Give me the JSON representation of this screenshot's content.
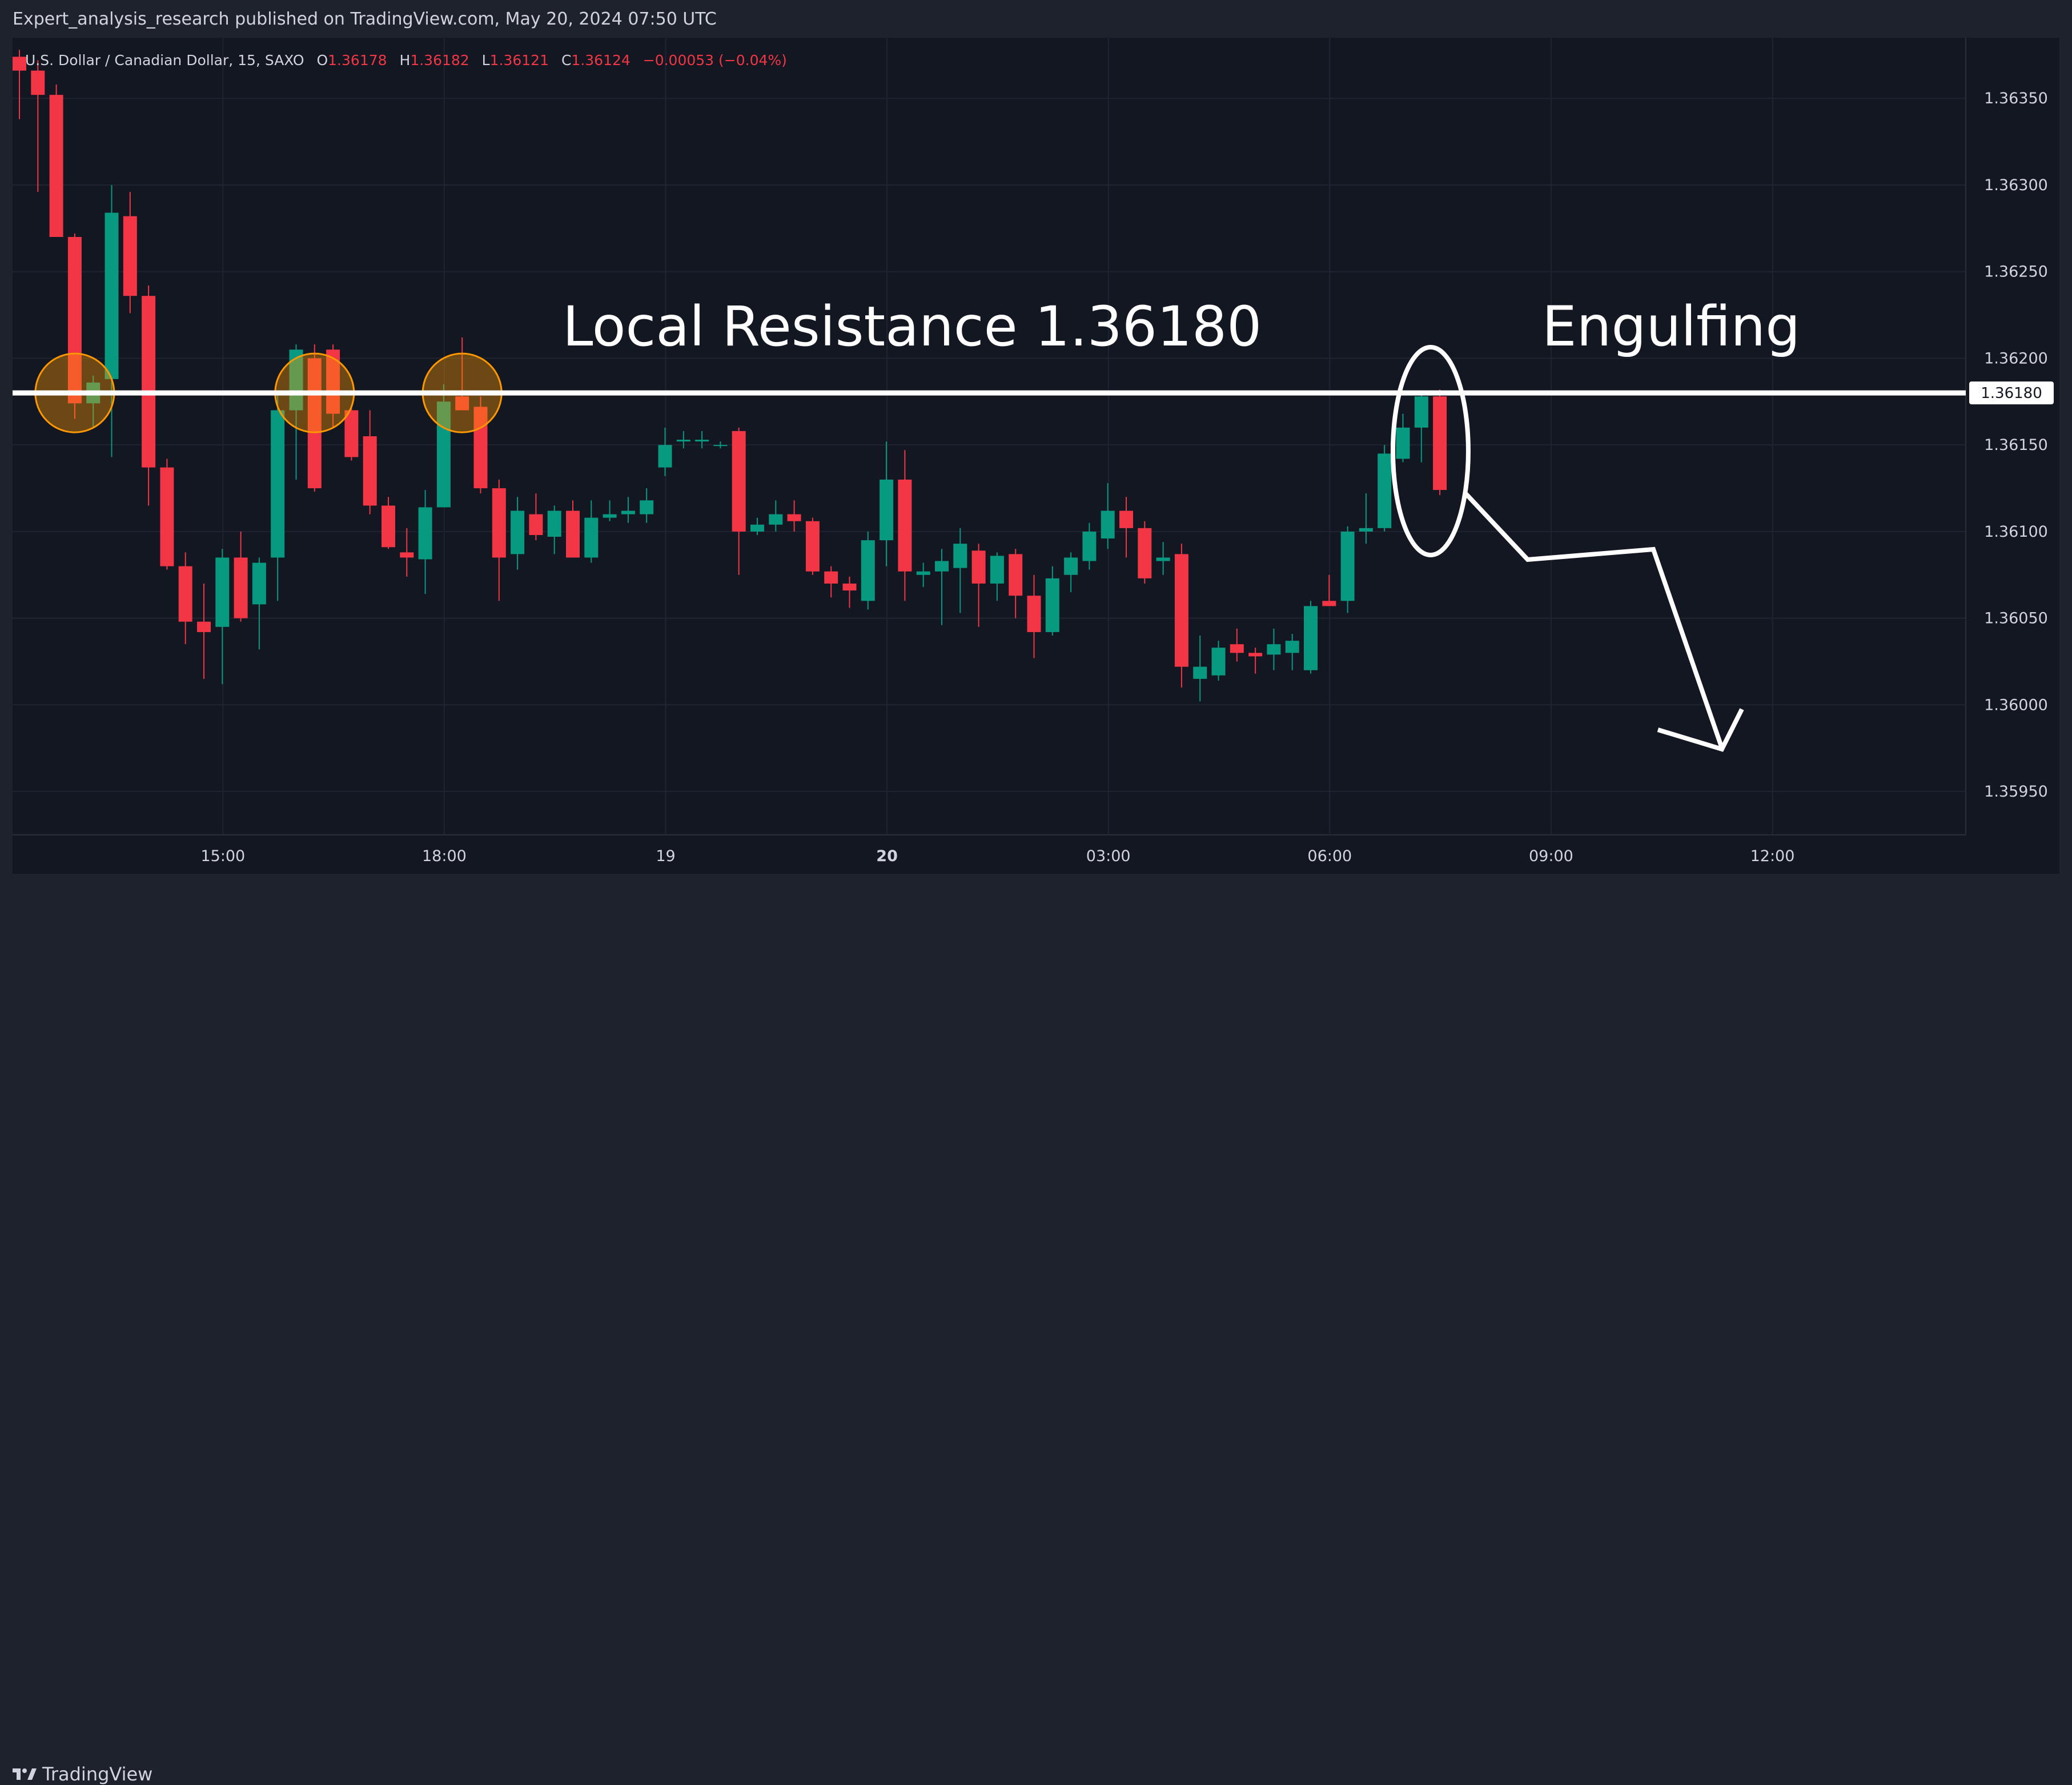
{
  "header": {
    "published": "Expert_analysis_research published on TradingView.com, May 20, 2024 07:50 UTC"
  },
  "legend": {
    "symbol": "U.S. Dollar / Canadian Dollar, 15, SAXO",
    "o_label": "O",
    "o_value": "1.36178",
    "h_label": "H",
    "h_value": "1.36182",
    "l_label": "L",
    "l_value": "1.36121",
    "c_label": "C",
    "c_value": "1.36124",
    "change": "−0.00053 (−0.04%)"
  },
  "footer": {
    "brand": "TradingView"
  },
  "colors": {
    "up": "#089981",
    "down": "#f23645",
    "background": "#131722",
    "text": "#d1d4dc"
  },
  "chart_data": {
    "type": "candlestick",
    "symbol": "USDCAD",
    "timeframe": "15",
    "ylim": [
      1.35925,
      1.36385
    ],
    "y_ticks": [
      "1.36350",
      "1.36300",
      "1.36250",
      "1.36200",
      "1.36150",
      "1.36100",
      "1.36050",
      "1.36000",
      "1.35950"
    ],
    "x_ticks": [
      "15:00",
      "18:00",
      "19",
      "20",
      "03:00",
      "06:00",
      "09:00",
      "12:00"
    ],
    "x_tick_bars": [
      11,
      23,
      35,
      47,
      59,
      71,
      83,
      95
    ],
    "bold_x_ticks": [
      "20"
    ],
    "resistance": {
      "value": 1.3618,
      "label": "1.36180"
    },
    "annotations": {
      "resistance_text": "Local Resistance 1.36180",
      "pattern_text": "Engulfing"
    },
    "circled_bars": [
      3,
      16,
      24
    ],
    "ellipse_bars": [
      76,
      77
    ],
    "candles": [
      [
        1.36374,
        1.36378,
        1.36338,
        1.36366
      ],
      [
        1.36366,
        1.36372,
        1.36296,
        1.36352
      ],
      [
        1.36352,
        1.36358,
        1.3627,
        1.3627
      ],
      [
        1.3627,
        1.36272,
        1.36165,
        1.36174
      ],
      [
        1.36174,
        1.3619,
        1.3616,
        1.36186
      ],
      [
        1.36188,
        1.363,
        1.36143,
        1.36284
      ],
      [
        1.36282,
        1.36296,
        1.36226,
        1.36236
      ],
      [
        1.36236,
        1.36242,
        1.36115,
        1.36137
      ],
      [
        1.36137,
        1.36142,
        1.36078,
        1.3608
      ],
      [
        1.3608,
        1.36088,
        1.36035,
        1.36048
      ],
      [
        1.36048,
        1.3607,
        1.36015,
        1.36042
      ],
      [
        1.36045,
        1.3609,
        1.36012,
        1.36085
      ],
      [
        1.36085,
        1.361,
        1.36048,
        1.3605
      ],
      [
        1.36058,
        1.36085,
        1.36032,
        1.36082
      ],
      [
        1.36085,
        1.3618,
        1.3606,
        1.3617
      ],
      [
        1.3617,
        1.36208,
        1.3613,
        1.36205
      ],
      [
        1.362,
        1.36208,
        1.36123,
        1.36125
      ],
      [
        1.36205,
        1.36208,
        1.3616,
        1.36168
      ],
      [
        1.3617,
        1.36172,
        1.36141,
        1.36143
      ],
      [
        1.36155,
        1.3617,
        1.3611,
        1.36115
      ],
      [
        1.36115,
        1.3612,
        1.3609,
        1.36091
      ],
      [
        1.36088,
        1.36102,
        1.36074,
        1.36085
      ],
      [
        1.36084,
        1.36124,
        1.36064,
        1.36114
      ],
      [
        1.36114,
        1.36185,
        1.36114,
        1.36175
      ],
      [
        1.36178,
        1.36212,
        1.36172,
        1.3617
      ],
      [
        1.36172,
        1.36178,
        1.36122,
        1.36125
      ],
      [
        1.36125,
        1.3613,
        1.3606,
        1.36085
      ],
      [
        1.36087,
        1.3612,
        1.36078,
        1.36112
      ],
      [
        1.3611,
        1.36122,
        1.36095,
        1.36098
      ],
      [
        1.36097,
        1.36115,
        1.36087,
        1.36112
      ],
      [
        1.36112,
        1.36118,
        1.36085,
        1.36085
      ],
      [
        1.36085,
        1.36118,
        1.36082,
        1.36108
      ],
      [
        1.36108,
        1.36118,
        1.36106,
        1.3611
      ],
      [
        1.3611,
        1.3612,
        1.36105,
        1.36112
      ],
      [
        1.3611,
        1.36125,
        1.36105,
        1.36118
      ],
      [
        1.36137,
        1.3616,
        1.36132,
        1.3615
      ],
      [
        1.36152,
        1.36158,
        1.36148,
        1.36153
      ],
      [
        1.36152,
        1.36158,
        1.36148,
        1.36153
      ],
      [
        1.3615,
        1.36152,
        1.36148,
        1.3615
      ],
      [
        1.36158,
        1.3616,
        1.36075,
        1.361
      ],
      [
        1.361,
        1.36108,
        1.36098,
        1.36104
      ],
      [
        1.36104,
        1.36118,
        1.361,
        1.3611
      ],
      [
        1.3611,
        1.36118,
        1.361,
        1.36106
      ],
      [
        1.36106,
        1.36108,
        1.36075,
        1.36077
      ],
      [
        1.36077,
        1.3608,
        1.36062,
        1.3607
      ],
      [
        1.3607,
        1.36074,
        1.36056,
        1.36066
      ],
      [
        1.3606,
        1.361,
        1.36055,
        1.36095
      ],
      [
        1.36095,
        1.36152,
        1.3608,
        1.3613
      ],
      [
        1.3613,
        1.36147,
        1.3606,
        1.36077
      ],
      [
        1.36075,
        1.36082,
        1.36068,
        1.36077
      ],
      [
        1.36077,
        1.3609,
        1.36046,
        1.36083
      ],
      [
        1.36079,
        1.36102,
        1.36053,
        1.36093
      ],
      [
        1.36089,
        1.36093,
        1.36045,
        1.3607
      ],
      [
        1.3607,
        1.36088,
        1.3606,
        1.36086
      ],
      [
        1.36087,
        1.3609,
        1.3605,
        1.36063
      ],
      [
        1.36063,
        1.36075,
        1.36027,
        1.36042
      ],
      [
        1.36042,
        1.3608,
        1.3604,
        1.36073
      ],
      [
        1.36075,
        1.36088,
        1.36065,
        1.36085
      ],
      [
        1.36083,
        1.36105,
        1.36078,
        1.361
      ],
      [
        1.36096,
        1.36128,
        1.3609,
        1.36112
      ],
      [
        1.36112,
        1.3612,
        1.36085,
        1.36102
      ],
      [
        1.36102,
        1.36106,
        1.3607,
        1.36073
      ],
      [
        1.36083,
        1.36094,
        1.36075,
        1.36085
      ],
      [
        1.36087,
        1.36093,
        1.3601,
        1.36022
      ],
      [
        1.36015,
        1.3604,
        1.36002,
        1.36022
      ],
      [
        1.36017,
        1.36037,
        1.36014,
        1.36033
      ],
      [
        1.36035,
        1.36044,
        1.36025,
        1.3603
      ],
      [
        1.3603,
        1.36033,
        1.36018,
        1.36028
      ],
      [
        1.36029,
        1.36044,
        1.3602,
        1.36035
      ],
      [
        1.3603,
        1.36041,
        1.3602,
        1.36037
      ],
      [
        1.3602,
        1.3606,
        1.36018,
        1.36057
      ],
      [
        1.3606,
        1.36075,
        1.36057,
        1.36057
      ],
      [
        1.3606,
        1.36103,
        1.36053,
        1.361
      ],
      [
        1.361,
        1.36122,
        1.36093,
        1.36102
      ],
      [
        1.36102,
        1.3615,
        1.361,
        1.36145
      ],
      [
        1.36142,
        1.36168,
        1.3614,
        1.3616
      ],
      [
        1.3616,
        1.3618,
        1.3614,
        1.36178
      ],
      [
        1.36178,
        1.36182,
        1.36121,
        1.36124
      ]
    ]
  }
}
